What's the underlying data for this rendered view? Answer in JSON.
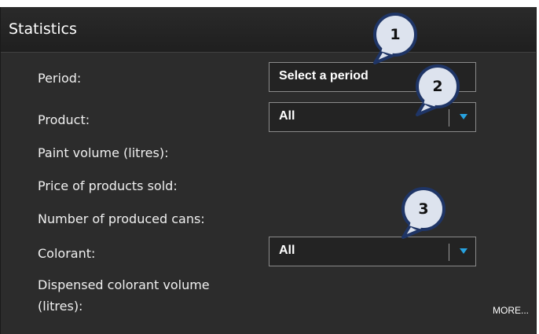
{
  "header": {
    "title": "Statistics"
  },
  "rows": [
    {
      "label": "Period:"
    },
    {
      "label": "Product:"
    },
    {
      "label": "Paint volume (litres):"
    },
    {
      "label": "Price of products sold:"
    },
    {
      "label": "Number of produced cans:"
    },
    {
      "label": "Colorant:"
    },
    {
      "label": "Dispensed colorant volume"
    },
    {
      "label": "(litres):"
    }
  ],
  "period_field": {
    "value": "Select a period"
  },
  "product_select": {
    "value": "All"
  },
  "colorant_select": {
    "value": "All"
  },
  "more_link": {
    "label": "MORE..."
  },
  "callouts": [
    "1",
    "2",
    "3"
  ],
  "colors": {
    "panel_background": "#2c2c2c",
    "dropdown_arrow": "#27a2e0",
    "callout_fill": "#dde3ee",
    "callout_border": "#1f3566"
  }
}
